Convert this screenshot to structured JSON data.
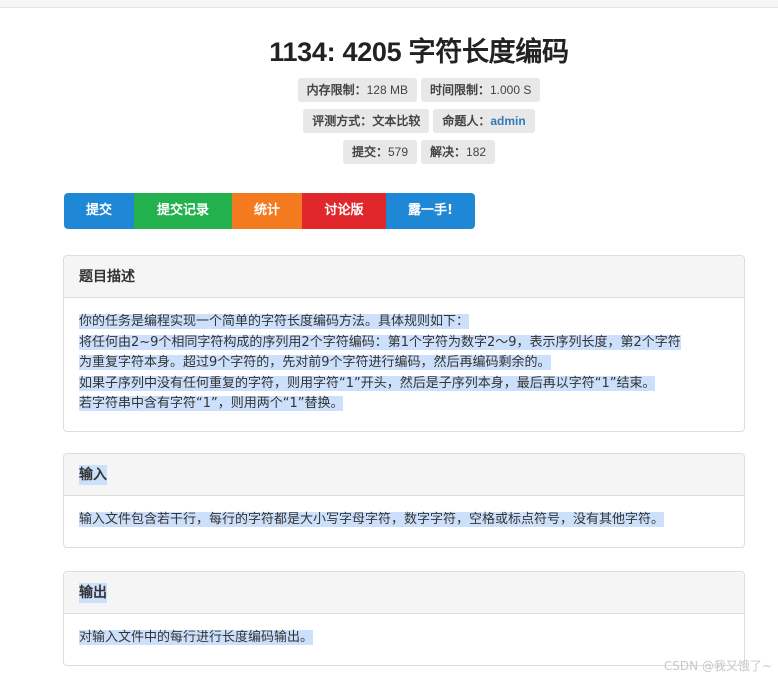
{
  "problem": {
    "title": "1134: 4205 字符长度编码",
    "memory_label": "内存限制：",
    "memory_value": "128 MB",
    "time_label": "时间限制：",
    "time_value": "1.000 S",
    "judge_label": "评测方式：",
    "judge_value": "文本比较",
    "author_label": "命题人：",
    "author_value": "admin",
    "submit_label": "提交：",
    "submit_value": "579",
    "solved_label": "解决：",
    "solved_value": "182"
  },
  "actions": [
    {
      "label": "提交",
      "color": "#1f88d6"
    },
    {
      "label": "提交记录",
      "color": "#22b14c"
    },
    {
      "label": "统计",
      "color": "#f37a1f"
    },
    {
      "label": "讨论版",
      "color": "#e0282c"
    },
    {
      "label": "露一手!",
      "color": "#1f88d6"
    }
  ],
  "sections": {
    "description": {
      "heading": "题目描述",
      "lines": [
        "你的任务是编程实现一个简单的字符长度编码方法。具体规则如下：",
        "将任何由2~9个相同字符构成的序列用2个字符编码：第1个字符为数字2～9，表示序列长度，第2个字符",
        "为重复字符本身。超过9个字符的，先对前9个字符进行编码，然后再编码剩余的。",
        "如果子序列中没有任何重复的字符，则用字符“1”开头，然后是子序列本身，最后再以字符“1”结束。",
        "若字符串中含有字符“1”，则用两个“1”替换。"
      ]
    },
    "input": {
      "heading": "输入",
      "text": "输入文件包含若干行，每行的字符都是大小写字母字符，数字字符，空格或标点符号，没有其他字符。"
    },
    "output": {
      "heading": "输出",
      "text": "对输入文件中的每行进行长度编码输出。"
    }
  },
  "watermark": "CSDN @我又饿了~"
}
